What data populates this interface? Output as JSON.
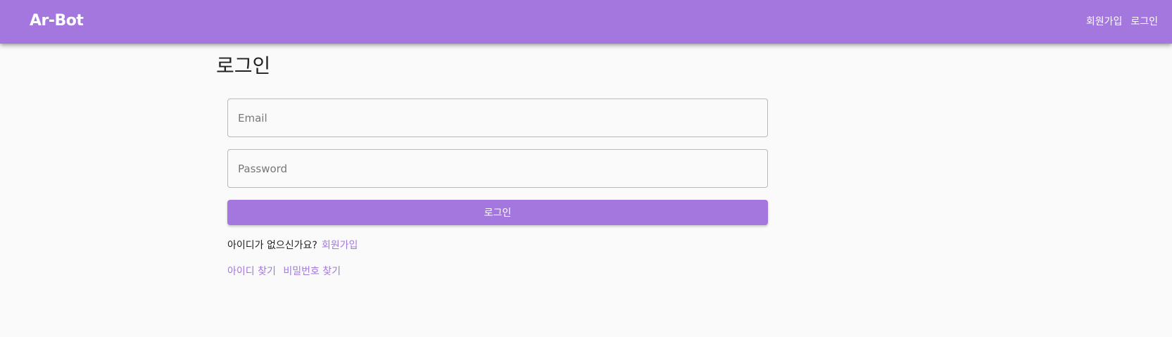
{
  "header": {
    "brand": "Ar-Bot",
    "nav": {
      "signup": "회원가입",
      "login": "로그인"
    }
  },
  "main": {
    "title": "로그인",
    "email": {
      "placeholder": "Email",
      "value": ""
    },
    "password": {
      "placeholder": "Password",
      "value": ""
    },
    "submit_label": "로그인",
    "signup_prompt": "아이디가 없으신가요?",
    "signup_link": "회원가입",
    "find_id": "아이디 찾기",
    "find_password": "비밀번호 찾기"
  },
  "colors": {
    "accent": "#a377de",
    "background": "#fafafa"
  }
}
